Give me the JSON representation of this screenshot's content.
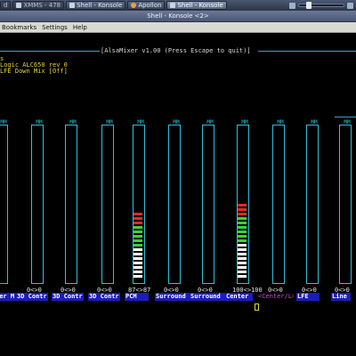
{
  "taskbar": {
    "tasks": [
      {
        "label": "d"
      },
      {
        "label": "XMMS - 478"
      },
      {
        "label": "Shell - Konsole"
      },
      {
        "label": "Apollon"
      },
      {
        "label": "Shell - Konsole"
      }
    ]
  },
  "window": {
    "title": "Shell - Konsole <2>"
  },
  "menubar": {
    "items": [
      "Bookmarks",
      "Settings",
      "Help"
    ]
  },
  "mixer": {
    "title": "[AlsaMixer v1.00 (Press Escape to quit)]",
    "info_lines": [
      "s",
      "Logic ALC650 rev 0",
      "LFE Down Mix [Off]"
    ],
    "channel_tag": "MM",
    "channels": [
      {
        "label": "ter M",
        "volume": "",
        "level_percent": 0
      },
      {
        "label": "3D Contr",
        "volume": "0<>0",
        "level_percent": 0
      },
      {
        "label": "3D Contr",
        "volume": "0<>0",
        "level_percent": 0
      },
      {
        "label": "3D Contr",
        "volume": "0<>0",
        "level_percent": 0
      },
      {
        "label": "PCM",
        "volume": "87<>87",
        "level_percent": 87
      },
      {
        "label": "Surround",
        "volume": "0<>0",
        "level_percent": 0
      },
      {
        "label": "Surround",
        "volume": "0<>0",
        "level_percent": 0
      },
      {
        "label": "Center",
        "volume": "100<>100",
        "level_percent": 100
      },
      {
        "label": "<Center/L>",
        "volume": "0<>0",
        "level_percent": 0,
        "selected": true
      },
      {
        "label": "LFE",
        "volume": "0<>0",
        "level_percent": 0
      },
      {
        "label": "Line",
        "volume": "0<>0",
        "level_percent": 0
      }
    ]
  },
  "colors": {
    "frame": "#30bfd9",
    "info": "#e8d23a",
    "label_bg": "#1c1cb8",
    "selected_label": "#d24ad2",
    "seg_white": "#ffffff",
    "seg_green": "#3ad23a",
    "seg_red": "#e02a2a"
  }
}
